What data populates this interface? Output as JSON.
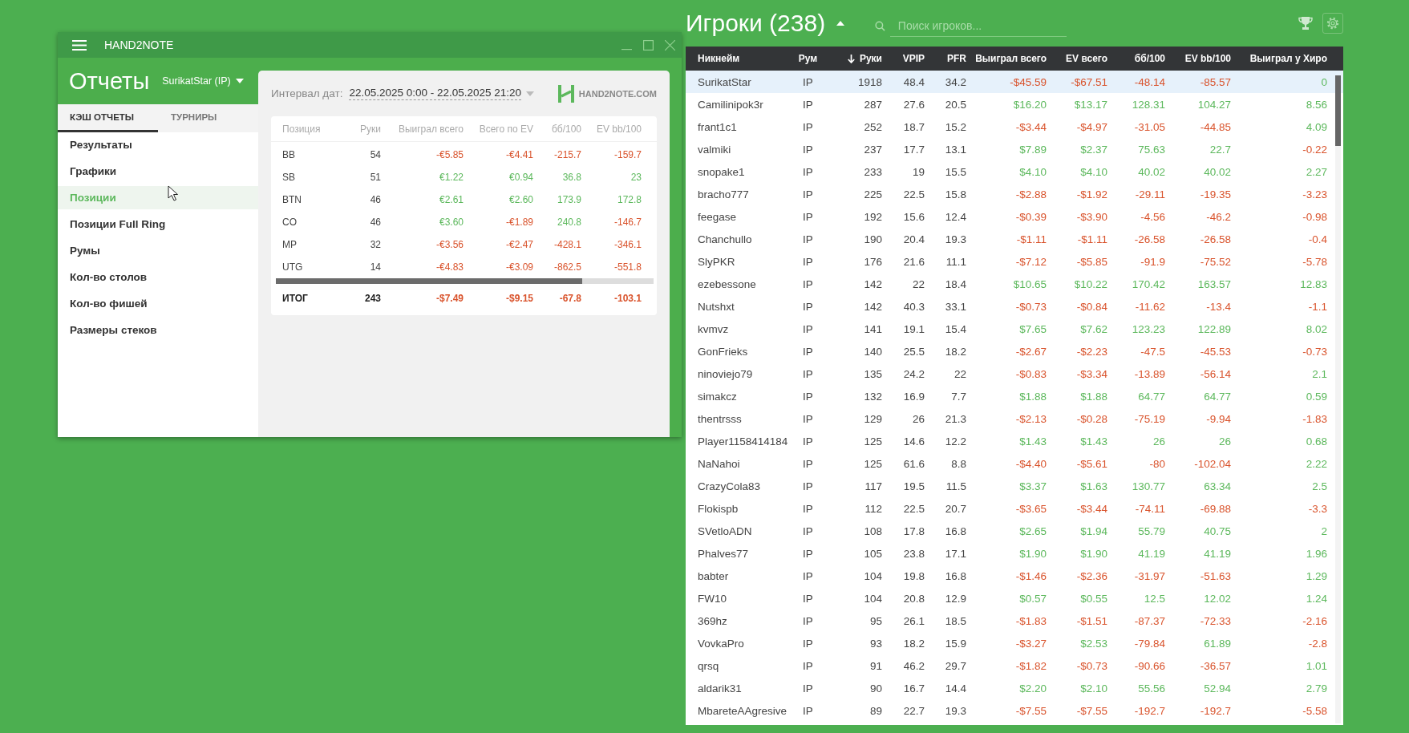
{
  "reports_window": {
    "title": "HAND2NOTE",
    "heading": "Отчеты",
    "player_filter": "SurikatStar (IP)",
    "tabs": [
      {
        "label": "КЭШ ОТЧЕТЫ",
        "selected": true
      },
      {
        "label": "ТУРНИРЫ",
        "selected": false
      }
    ],
    "menu": [
      {
        "label": "Результаты",
        "selected": false
      },
      {
        "label": "Графики",
        "selected": false
      },
      {
        "label": "Позиции",
        "selected": true
      },
      {
        "label": "Позиции Full Ring",
        "selected": false
      },
      {
        "label": "Румы",
        "selected": false
      },
      {
        "label": "Кол-во столов",
        "selected": false
      },
      {
        "label": "Кол-во фишей",
        "selected": false
      },
      {
        "label": "Размеры стеков",
        "selected": false
      }
    ],
    "date_label": "Интервал дат:",
    "date_range": "22.05.2025 0:00 - 22.05.2025 21:20",
    "logo_text": "HAND2NOTE.COM",
    "table": {
      "columns": [
        "Позиция",
        "Руки",
        "Выиграл всего",
        "Всего по EV",
        "бб/100",
        "EV bb/100"
      ],
      "rows": [
        {
          "position": "BB",
          "hands": "54",
          "values": [
            "-€5.85",
            "-€4.41",
            "-215.7",
            "-159.7"
          ],
          "negative": [
            true,
            true,
            true,
            true
          ]
        },
        {
          "position": "SB",
          "hands": "51",
          "values": [
            "€1.22",
            "€0.94",
            "36.8",
            "23"
          ],
          "negative": [
            false,
            false,
            false,
            false
          ]
        },
        {
          "position": "BTN",
          "hands": "46",
          "values": [
            "€2.61",
            "€2.60",
            "173.9",
            "172.8"
          ],
          "negative": [
            false,
            false,
            false,
            false
          ]
        },
        {
          "position": "CO",
          "hands": "46",
          "values": [
            "€3.60",
            "-€1.89",
            "240.8",
            "-146.7"
          ],
          "negative": [
            false,
            true,
            false,
            true
          ]
        },
        {
          "position": "MP",
          "hands": "32",
          "values": [
            "-€3.56",
            "-€2.47",
            "-428.1",
            "-346.1"
          ],
          "negative": [
            true,
            true,
            true,
            true
          ]
        },
        {
          "position": "UTG",
          "hands": "14",
          "values": [
            "-€4.83",
            "-€3.09",
            "-862.5",
            "-551.8"
          ],
          "negative": [
            true,
            true,
            true,
            true
          ]
        }
      ],
      "total": {
        "label": "ИТОГ",
        "hands": "243",
        "values": [
          "-$7.49",
          "-$9.15",
          "-67.8",
          "-103.1"
        ],
        "negative": [
          true,
          true,
          true,
          true
        ]
      }
    }
  },
  "players_panel": {
    "title": "Игроки (238)",
    "search": {
      "placeholder": "Поиск игроков..."
    },
    "table": {
      "columns": [
        {
          "label": "Никнейм",
          "sorted": false
        },
        {
          "label": "Рум",
          "sorted": false
        },
        {
          "label": "Руки",
          "sorted": true
        },
        {
          "label": "VPIP",
          "sorted": false
        },
        {
          "label": "PFR",
          "sorted": false
        },
        {
          "label": "Выиграл всего",
          "sorted": false
        },
        {
          "label": "EV всего",
          "sorted": false
        },
        {
          "label": "бб/100",
          "sorted": false
        },
        {
          "label": "EV bb/100",
          "sorted": false
        },
        {
          "label": "Выиграл у Хиро",
          "sorted": false
        }
      ],
      "rows": [
        {
          "nickname": "SurikatStar",
          "room": "IP",
          "hands": "1918",
          "vpip": "48.4",
          "pfr": "34.2",
          "values": [
            "-$45.59",
            "-$67.51",
            "-48.14",
            "-85.57",
            "0"
          ],
          "negative": [
            true,
            true,
            true,
            true,
            false
          ],
          "selected": true
        },
        {
          "nickname": "Camilinipok3r",
          "room": "IP",
          "hands": "287",
          "vpip": "27.6",
          "pfr": "20.5",
          "values": [
            "$16.20",
            "$13.17",
            "128.31",
            "104.27",
            "8.56"
          ],
          "negative": [
            false,
            false,
            false,
            false,
            false
          ],
          "selected": false
        },
        {
          "nickname": "frant1c1",
          "room": "IP",
          "hands": "252",
          "vpip": "18.7",
          "pfr": "15.2",
          "values": [
            "-$3.44",
            "-$4.97",
            "-31.05",
            "-44.85",
            "4.09"
          ],
          "negative": [
            true,
            true,
            true,
            true,
            false
          ],
          "selected": false
        },
        {
          "nickname": "valmiki",
          "room": "IP",
          "hands": "237",
          "vpip": "17.7",
          "pfr": "13.1",
          "values": [
            "$7.89",
            "$2.37",
            "75.63",
            "22.7",
            "-0.22"
          ],
          "negative": [
            false,
            false,
            false,
            false,
            true
          ],
          "selected": false
        },
        {
          "nickname": "snopake1",
          "room": "IP",
          "hands": "233",
          "vpip": "19",
          "pfr": "15.5",
          "values": [
            "$4.10",
            "$4.10",
            "40.02",
            "40.02",
            "2.27"
          ],
          "negative": [
            false,
            false,
            false,
            false,
            false
          ],
          "selected": false
        },
        {
          "nickname": "bracho777",
          "room": "IP",
          "hands": "225",
          "vpip": "22.5",
          "pfr": "15.8",
          "values": [
            "-$2.88",
            "-$1.92",
            "-29.11",
            "-19.35",
            "-3.23"
          ],
          "negative": [
            true,
            true,
            true,
            true,
            true
          ],
          "selected": false
        },
        {
          "nickname": "feegase",
          "room": "IP",
          "hands": "192",
          "vpip": "15.6",
          "pfr": "12.4",
          "values": [
            "-$0.39",
            "-$3.90",
            "-4.56",
            "-46.2",
            "-0.98"
          ],
          "negative": [
            true,
            true,
            true,
            true,
            true
          ],
          "selected": false
        },
        {
          "nickname": "Chanchullo",
          "room": "IP",
          "hands": "190",
          "vpip": "20.4",
          "pfr": "19.3",
          "values": [
            "-$1.11",
            "-$1.11",
            "-26.58",
            "-26.58",
            "-0.4"
          ],
          "negative": [
            true,
            true,
            true,
            true,
            true
          ],
          "selected": false
        },
        {
          "nickname": "SlyPKR",
          "room": "IP",
          "hands": "176",
          "vpip": "21.6",
          "pfr": "11.1",
          "values": [
            "-$7.12",
            "-$5.85",
            "-91.9",
            "-75.52",
            "-5.78"
          ],
          "negative": [
            true,
            true,
            true,
            true,
            true
          ],
          "selected": false
        },
        {
          "nickname": "ezebessone",
          "room": "IP",
          "hands": "142",
          "vpip": "22",
          "pfr": "18.4",
          "values": [
            "$10.65",
            "$10.22",
            "170.42",
            "163.57",
            "12.83"
          ],
          "negative": [
            false,
            false,
            false,
            false,
            false
          ],
          "selected": false
        },
        {
          "nickname": "Nutshxt",
          "room": "IP",
          "hands": "142",
          "vpip": "40.3",
          "pfr": "33.1",
          "values": [
            "-$0.73",
            "-$0.84",
            "-11.62",
            "-13.4",
            "-1.1"
          ],
          "negative": [
            true,
            true,
            true,
            true,
            true
          ],
          "selected": false
        },
        {
          "nickname": "kvmvz",
          "room": "IP",
          "hands": "141",
          "vpip": "19.1",
          "pfr": "15.4",
          "values": [
            "$7.65",
            "$7.62",
            "123.23",
            "122.89",
            "8.02"
          ],
          "negative": [
            false,
            false,
            false,
            false,
            false
          ],
          "selected": false
        },
        {
          "nickname": "GonFrieks",
          "room": "IP",
          "hands": "140",
          "vpip": "25.5",
          "pfr": "18.2",
          "values": [
            "-$2.67",
            "-$2.23",
            "-47.5",
            "-45.53",
            "-0.73"
          ],
          "negative": [
            true,
            true,
            true,
            true,
            true
          ],
          "selected": false
        },
        {
          "nickname": "ninoviejo79",
          "room": "IP",
          "hands": "135",
          "vpip": "24.2",
          "pfr": "22",
          "values": [
            "-$0.83",
            "-$3.34",
            "-13.89",
            "-56.14",
            "2.1"
          ],
          "negative": [
            true,
            true,
            true,
            true,
            false
          ],
          "selected": false
        },
        {
          "nickname": "simakcz",
          "room": "IP",
          "hands": "132",
          "vpip": "16.9",
          "pfr": "7.7",
          "values": [
            "$1.88",
            "$1.88",
            "64.77",
            "64.77",
            "0.59"
          ],
          "negative": [
            false,
            false,
            false,
            false,
            false
          ],
          "selected": false
        },
        {
          "nickname": "thentrsss",
          "room": "IP",
          "hands": "129",
          "vpip": "26",
          "pfr": "21.3",
          "values": [
            "-$2.13",
            "-$0.28",
            "-75.19",
            "-9.94",
            "-1.83"
          ],
          "negative": [
            true,
            true,
            true,
            true,
            true
          ],
          "selected": false
        },
        {
          "nickname": "Player1158414184",
          "room": "IP",
          "hands": "125",
          "vpip": "14.6",
          "pfr": "12.2",
          "values": [
            "$1.43",
            "$1.43",
            "26",
            "26",
            "0.68"
          ],
          "negative": [
            false,
            false,
            false,
            false,
            false
          ],
          "selected": false
        },
        {
          "nickname": "NaNahoi",
          "room": "IP",
          "hands": "125",
          "vpip": "61.6",
          "pfr": "8.8",
          "values": [
            "-$4.40",
            "-$5.61",
            "-80",
            "-102.04",
            "2.22"
          ],
          "negative": [
            true,
            true,
            true,
            true,
            false
          ],
          "selected": false
        },
        {
          "nickname": "CrazyCola83",
          "room": "IP",
          "hands": "117",
          "vpip": "19.5",
          "pfr": "11.5",
          "values": [
            "$3.37",
            "$1.63",
            "130.77",
            "63.34",
            "2.5"
          ],
          "negative": [
            false,
            false,
            false,
            false,
            false
          ],
          "selected": false
        },
        {
          "nickname": "Flokispb",
          "room": "IP",
          "hands": "112",
          "vpip": "22.5",
          "pfr": "20.7",
          "values": [
            "-$3.65",
            "-$3.44",
            "-74.11",
            "-69.88",
            "-3.3"
          ],
          "negative": [
            true,
            true,
            true,
            true,
            true
          ],
          "selected": false
        },
        {
          "nickname": "SVetloADN",
          "room": "IP",
          "hands": "108",
          "vpip": "17.8",
          "pfr": "16.8",
          "values": [
            "$2.65",
            "$1.94",
            "55.79",
            "40.75",
            "2"
          ],
          "negative": [
            false,
            false,
            false,
            false,
            false
          ],
          "selected": false
        },
        {
          "nickname": "Phalves77",
          "room": "IP",
          "hands": "105",
          "vpip": "23.8",
          "pfr": "17.1",
          "values": [
            "$1.90",
            "$1.90",
            "41.19",
            "41.19",
            "1.96"
          ],
          "negative": [
            false,
            false,
            false,
            false,
            false
          ],
          "selected": false
        },
        {
          "nickname": "babter",
          "room": "IP",
          "hands": "104",
          "vpip": "19.8",
          "pfr": "16.8",
          "values": [
            "-$1.46",
            "-$2.36",
            "-31.97",
            "-51.63",
            "1.29"
          ],
          "negative": [
            true,
            true,
            true,
            true,
            false
          ],
          "selected": false
        },
        {
          "nickname": "FW10",
          "room": "IP",
          "hands": "104",
          "vpip": "20.8",
          "pfr": "12.9",
          "values": [
            "$0.57",
            "$0.55",
            "12.5",
            "12.02",
            "1.24"
          ],
          "negative": [
            false,
            false,
            false,
            false,
            false
          ],
          "selected": false
        },
        {
          "nickname": "369hz",
          "room": "IP",
          "hands": "95",
          "vpip": "26.1",
          "pfr": "18.5",
          "values": [
            "-$1.83",
            "-$1.51",
            "-87.37",
            "-72.33",
            "-2.16"
          ],
          "negative": [
            true,
            true,
            true,
            true,
            true
          ],
          "selected": false
        },
        {
          "nickname": "VovkaPro",
          "room": "IP",
          "hands": "93",
          "vpip": "18.2",
          "pfr": "15.9",
          "values": [
            "-$3.27",
            "$2.53",
            "-79.84",
            "61.89",
            "-2.8"
          ],
          "negative": [
            true,
            false,
            true,
            false,
            true
          ],
          "selected": false
        },
        {
          "nickname": "qrsq",
          "room": "IP",
          "hands": "91",
          "vpip": "46.2",
          "pfr": "29.7",
          "values": [
            "-$1.82",
            "-$0.73",
            "-90.66",
            "-36.57",
            "1.01"
          ],
          "negative": [
            true,
            true,
            true,
            true,
            false
          ],
          "selected": false
        },
        {
          "nickname": "aldarik31",
          "room": "IP",
          "hands": "90",
          "vpip": "16.7",
          "pfr": "14.4",
          "values": [
            "$2.20",
            "$2.10",
            "55.56",
            "52.94",
            "2.79"
          ],
          "negative": [
            false,
            false,
            false,
            false,
            false
          ],
          "selected": false
        },
        {
          "nickname": "MbareteAAgresive",
          "room": "IP",
          "hands": "89",
          "vpip": "22.7",
          "pfr": "19.3",
          "values": [
            "-$7.55",
            "-$7.55",
            "-192.7",
            "-192.7",
            "-5.58"
          ],
          "negative": [
            true,
            true,
            true,
            true,
            true
          ],
          "selected": false
        }
      ]
    }
  }
}
